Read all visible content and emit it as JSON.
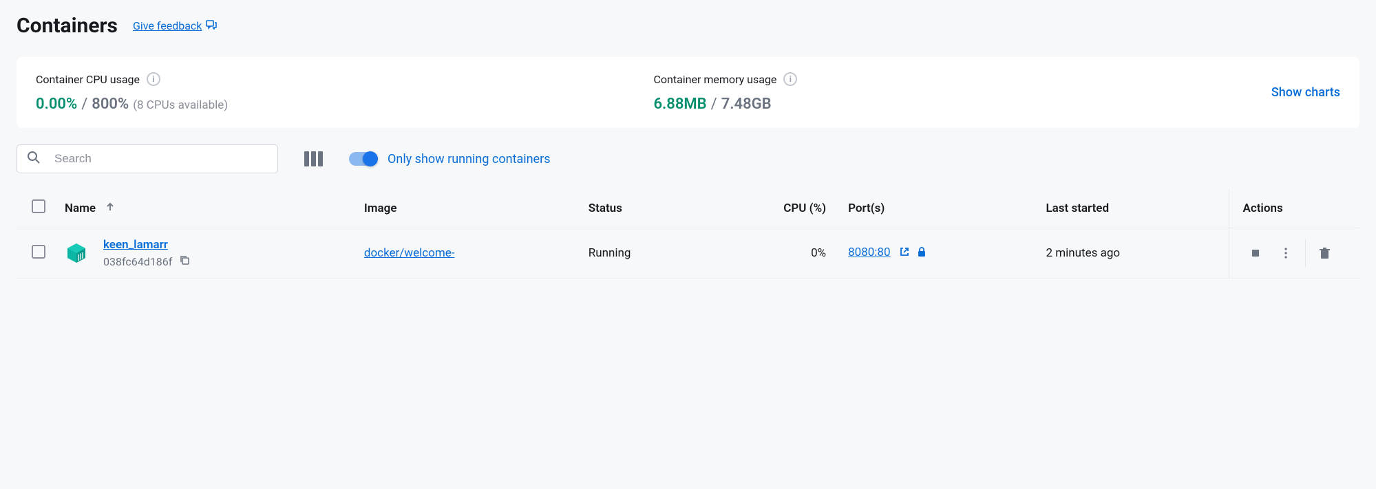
{
  "header": {
    "title": "Containers",
    "feedback_label": "Give feedback"
  },
  "stats": {
    "cpu": {
      "label": "Container CPU usage",
      "current": "0.00%",
      "separator": "/",
      "total": "800%",
      "detail": "(8 CPUs available)"
    },
    "memory": {
      "label": "Container memory usage",
      "current": "6.88MB",
      "separator": "/",
      "total": "7.48GB"
    },
    "show_charts": "Show charts"
  },
  "toolbar": {
    "search_placeholder": "Search",
    "toggle_label": "Only show running containers"
  },
  "table": {
    "headers": {
      "name": "Name",
      "image": "Image",
      "status": "Status",
      "cpu": "CPU (%)",
      "ports": "Port(s)",
      "last_started": "Last started",
      "actions": "Actions"
    },
    "rows": [
      {
        "name": "keen_lamarr",
        "id": "038fc64d186f",
        "image": "docker/welcome-",
        "status": "Running",
        "cpu": "0%",
        "port": "8080:80",
        "last_started": "2 minutes ago"
      }
    ]
  }
}
